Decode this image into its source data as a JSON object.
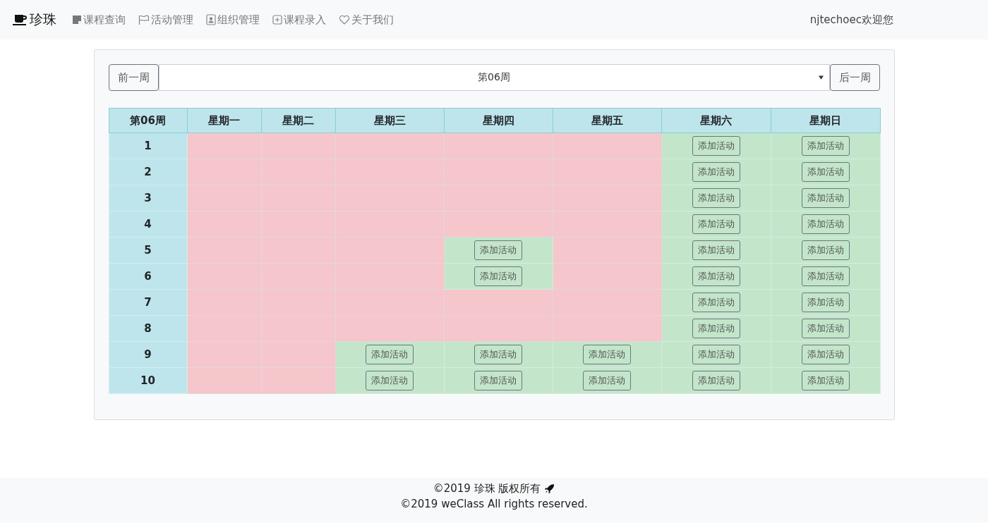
{
  "brand": "珍珠",
  "nav": [
    {
      "label": "课程查询",
      "kind": "note"
    },
    {
      "label": "活动管理",
      "kind": "flag"
    },
    {
      "label": "组织管理",
      "kind": "contact"
    },
    {
      "label": "课程录入",
      "kind": "plus"
    },
    {
      "label": "关于我们",
      "kind": "heart"
    }
  ],
  "user_greeting": "njtechoec欢迎您",
  "week_nav": {
    "prev": "前一周",
    "selected_week": "第06周",
    "next": "后一周"
  },
  "table": {
    "columns": [
      "第06周",
      "星期一",
      "星期二",
      "星期三",
      "星期四",
      "星期五",
      "星期六",
      "星期日"
    ],
    "rows": [
      {
        "cells": [
          {
            "kind": "period",
            "text": "1"
          },
          {
            "kind": "slot",
            "available": false
          },
          {
            "kind": "slot",
            "available": false
          },
          {
            "kind": "slot",
            "available": false
          },
          {
            "kind": "slot",
            "available": false
          },
          {
            "kind": "slot",
            "available": false
          },
          {
            "kind": "slot",
            "available": true,
            "action": "添加活动"
          },
          {
            "kind": "slot",
            "available": true,
            "action": "添加活动"
          }
        ]
      },
      {
        "cells": [
          {
            "kind": "period",
            "text": "2"
          },
          {
            "kind": "slot",
            "available": false
          },
          {
            "kind": "slot",
            "available": false
          },
          {
            "kind": "slot",
            "available": false
          },
          {
            "kind": "slot",
            "available": false
          },
          {
            "kind": "slot",
            "available": false
          },
          {
            "kind": "slot",
            "available": true,
            "action": "添加活动"
          },
          {
            "kind": "slot",
            "available": true,
            "action": "添加活动"
          }
        ]
      },
      {
        "cells": [
          {
            "kind": "period",
            "text": "3"
          },
          {
            "kind": "slot",
            "available": false
          },
          {
            "kind": "slot",
            "available": false
          },
          {
            "kind": "slot",
            "available": false
          },
          {
            "kind": "slot",
            "available": false
          },
          {
            "kind": "slot",
            "available": false
          },
          {
            "kind": "slot",
            "available": true,
            "action": "添加活动"
          },
          {
            "kind": "slot",
            "available": true,
            "action": "添加活动"
          }
        ]
      },
      {
        "cells": [
          {
            "kind": "period",
            "text": "4"
          },
          {
            "kind": "slot",
            "available": false
          },
          {
            "kind": "slot",
            "available": false
          },
          {
            "kind": "slot",
            "available": false
          },
          {
            "kind": "slot",
            "available": false
          },
          {
            "kind": "slot",
            "available": false
          },
          {
            "kind": "slot",
            "available": true,
            "action": "添加活动"
          },
          {
            "kind": "slot",
            "available": true,
            "action": "添加活动"
          }
        ]
      },
      {
        "cells": [
          {
            "kind": "period",
            "text": "5"
          },
          {
            "kind": "slot",
            "available": false
          },
          {
            "kind": "slot",
            "available": false
          },
          {
            "kind": "slot",
            "available": false
          },
          {
            "kind": "slot",
            "available": true,
            "action": "添加活动"
          },
          {
            "kind": "slot",
            "available": false
          },
          {
            "kind": "slot",
            "available": true,
            "action": "添加活动"
          },
          {
            "kind": "slot",
            "available": true,
            "action": "添加活动"
          }
        ]
      },
      {
        "cells": [
          {
            "kind": "period",
            "text": "6"
          },
          {
            "kind": "slot",
            "available": false
          },
          {
            "kind": "slot",
            "available": false
          },
          {
            "kind": "slot",
            "available": false
          },
          {
            "kind": "slot",
            "available": true,
            "action": "添加活动"
          },
          {
            "kind": "slot",
            "available": false
          },
          {
            "kind": "slot",
            "available": true,
            "action": "添加活动"
          },
          {
            "kind": "slot",
            "available": true,
            "action": "添加活动"
          }
        ]
      },
      {
        "cells": [
          {
            "kind": "period",
            "text": "7"
          },
          {
            "kind": "slot",
            "available": false
          },
          {
            "kind": "slot",
            "available": false
          },
          {
            "kind": "slot",
            "available": false
          },
          {
            "kind": "slot",
            "available": false
          },
          {
            "kind": "slot",
            "available": false
          },
          {
            "kind": "slot",
            "available": true,
            "action": "添加活动"
          },
          {
            "kind": "slot",
            "available": true,
            "action": "添加活动"
          }
        ]
      },
      {
        "cells": [
          {
            "kind": "period",
            "text": "8"
          },
          {
            "kind": "slot",
            "available": false
          },
          {
            "kind": "slot",
            "available": false
          },
          {
            "kind": "slot",
            "available": false
          },
          {
            "kind": "slot",
            "available": false
          },
          {
            "kind": "slot",
            "available": false
          },
          {
            "kind": "slot",
            "available": true,
            "action": "添加活动"
          },
          {
            "kind": "slot",
            "available": true,
            "action": "添加活动"
          }
        ]
      },
      {
        "cells": [
          {
            "kind": "period",
            "text": "9"
          },
          {
            "kind": "slot",
            "available": false
          },
          {
            "kind": "slot",
            "available": false
          },
          {
            "kind": "slot",
            "available": true,
            "action": "添加活动"
          },
          {
            "kind": "slot",
            "available": true,
            "action": "添加活动"
          },
          {
            "kind": "slot",
            "available": true,
            "action": "添加活动"
          },
          {
            "kind": "slot",
            "available": true,
            "action": "添加活动"
          },
          {
            "kind": "slot",
            "available": true,
            "action": "添加活动"
          }
        ]
      },
      {
        "cells": [
          {
            "kind": "period",
            "text": "10"
          },
          {
            "kind": "slot",
            "available": false
          },
          {
            "kind": "slot",
            "available": false
          },
          {
            "kind": "slot",
            "available": true,
            "action": "添加活动"
          },
          {
            "kind": "slot",
            "available": true,
            "action": "添加活动"
          },
          {
            "kind": "slot",
            "available": true,
            "action": "添加活动"
          },
          {
            "kind": "slot",
            "available": true,
            "action": "添加活动"
          },
          {
            "kind": "slot",
            "available": true,
            "action": "添加活动"
          }
        ]
      }
    ]
  },
  "footer": {
    "line_1": "©2019 珍珠 版权所有",
    "line_2": "©2019 weClass All rights reserved."
  }
}
